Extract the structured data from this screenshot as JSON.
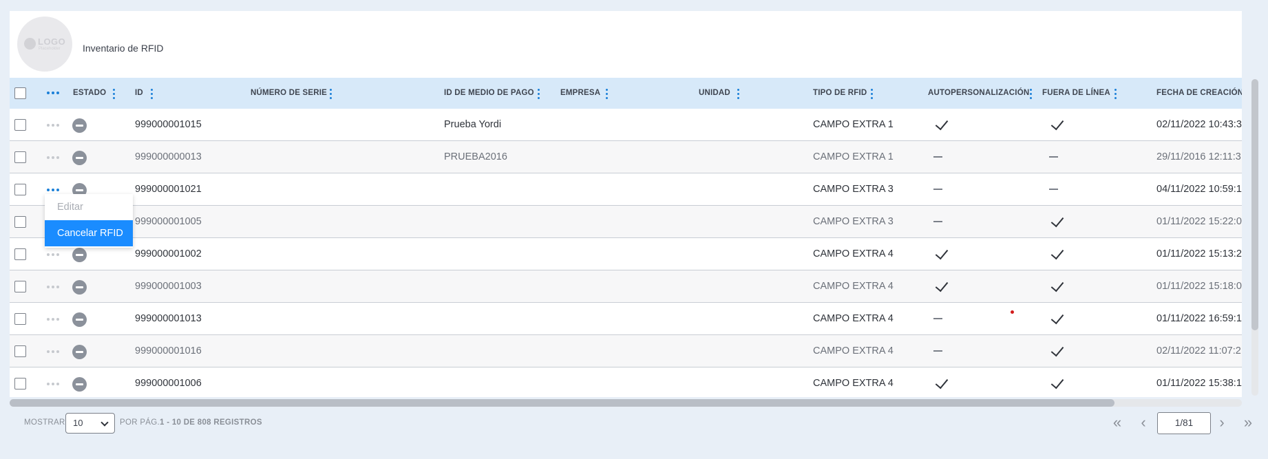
{
  "header": {
    "logo_text": "LOGO",
    "logo_sub": "Placeholder",
    "title": "Inventario de RFID"
  },
  "columns": [
    {
      "key": "estado",
      "label": "ESTADO"
    },
    {
      "key": "id",
      "label": "ID"
    },
    {
      "key": "serie",
      "label": "NÚMERO DE SERIE"
    },
    {
      "key": "medio",
      "label": "ID DE MEDIO DE PAGO"
    },
    {
      "key": "empresa",
      "label": "EMPRESA"
    },
    {
      "key": "unidad",
      "label": "UNIDAD"
    },
    {
      "key": "tipo",
      "label": "TIPO DE RFID"
    },
    {
      "key": "auto",
      "label": "AUTOPERSONALIZACIÓN"
    },
    {
      "key": "fuera",
      "label": "FUERA DE LÍNEA"
    },
    {
      "key": "fecha",
      "label": "FECHA DE CREACIÓN"
    }
  ],
  "rows": [
    {
      "id": "999000001015",
      "medio": "Prueba Yordi",
      "tipo": "CAMPO EXTRA 1",
      "auto": true,
      "fuera": true,
      "fecha": "02/11/2022 10:43:3",
      "menu_color": "#c6c9ce"
    },
    {
      "id": "999000000013",
      "medio": "PRUEBA2016",
      "tipo": "CAMPO EXTRA 1",
      "auto": false,
      "fuera": false,
      "fecha": "29/11/2016 12:11:3",
      "menu_color": "#c6c9ce"
    },
    {
      "id": "999000001021",
      "medio": "",
      "tipo": "CAMPO EXTRA 3",
      "auto": false,
      "fuera": false,
      "fecha": "04/11/2022 10:59:1",
      "menu_color": "#1a7fd8"
    },
    {
      "id": "999000001005",
      "medio": "",
      "tipo": "CAMPO EXTRA 3",
      "auto": false,
      "fuera": true,
      "fecha": "01/11/2022 15:22:0",
      "menu_color": "#c6c9ce"
    },
    {
      "id": "999000001002",
      "medio": "",
      "tipo": "CAMPO EXTRA 4",
      "auto": true,
      "fuera": true,
      "fecha": "01/11/2022 15:13:2",
      "menu_color": "#c6c9ce"
    },
    {
      "id": "999000001003",
      "medio": "",
      "tipo": "CAMPO EXTRA 4",
      "auto": true,
      "fuera": true,
      "fecha": "01/11/2022 15:18:0",
      "menu_color": "#c6c9ce"
    },
    {
      "id": "999000001013",
      "medio": "",
      "tipo": "CAMPO EXTRA 4",
      "auto": false,
      "fuera": true,
      "fecha": "01/11/2022 16:59:1",
      "menu_color": "#c6c9ce"
    },
    {
      "id": "999000001016",
      "medio": "",
      "tipo": "CAMPO EXTRA 4",
      "auto": false,
      "fuera": true,
      "fecha": "02/11/2022 11:07:2",
      "menu_color": "#c6c9ce"
    },
    {
      "id": "999000001006",
      "medio": "",
      "tipo": "CAMPO EXTRA 4",
      "auto": true,
      "fuera": true,
      "fecha": "01/11/2022 15:38:1",
      "menu_color": "#c6c9ce"
    }
  ],
  "context_menu": {
    "edit_label": "Editar",
    "cancel_label": "Cancelar RFID"
  },
  "footer": {
    "show_label": "MOSTRAR",
    "page_size": "10",
    "per_page_label": "POR PÁG.",
    "records_label": "1 - 10 DE 808 REGISTROS",
    "page_value": "1/81"
  },
  "colors": {
    "accent": "#1a8cff",
    "header_bg": "#d7e9f9",
    "page_bg": "#e8eff7"
  }
}
